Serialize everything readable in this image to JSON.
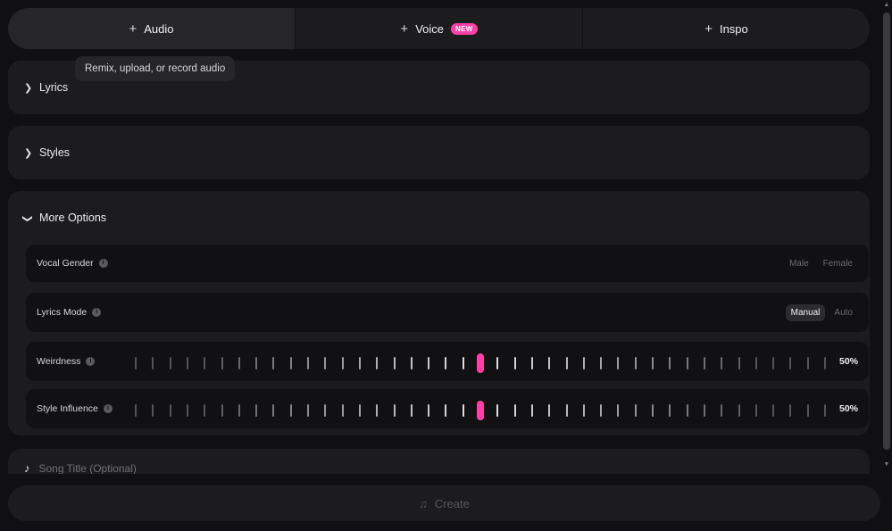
{
  "tabs": [
    {
      "label": "Audio",
      "icon": "plus-icon",
      "active": true
    },
    {
      "label": "Voice",
      "icon": "plus-icon",
      "badge": "NEW"
    },
    {
      "label": "Inspo",
      "icon": "plus-icon"
    }
  ],
  "tooltip": "Remix, upload, or record audio",
  "sections": {
    "lyrics": {
      "label": "Lyrics",
      "icon": "chevron-right-icon"
    },
    "styles": {
      "label": "Styles",
      "icon": "chevron-right-icon"
    },
    "more_options": {
      "label": "More Options",
      "icon": "chevron-down-icon"
    }
  },
  "options": {
    "vocal_gender": {
      "label": "Vocal Gender",
      "choices": [
        "Male",
        "Female"
      ],
      "selected": null
    },
    "lyrics_mode": {
      "label": "Lyrics Mode",
      "choices": [
        "Manual",
        "Auto"
      ],
      "selected": "Manual"
    },
    "weirdness": {
      "label": "Weirdness",
      "value": "50%",
      "fraction": 0.5
    },
    "style_influence": {
      "label": "Style Influence",
      "value": "50%",
      "fraction": 0.5
    }
  },
  "song_title": {
    "placeholder": "Song Title (Optional)",
    "value": ""
  },
  "create": {
    "label": "Create"
  },
  "colors": {
    "accent": "#ff3fa4",
    "panel": "#1c1c1f",
    "background": "#101012"
  }
}
